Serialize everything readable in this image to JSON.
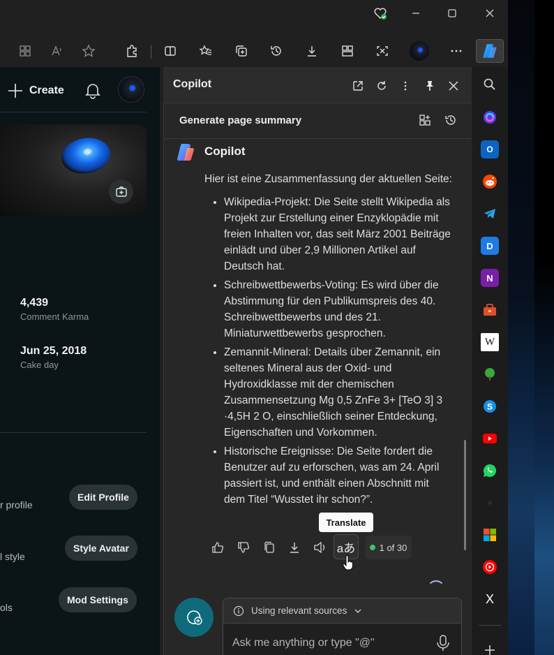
{
  "browser": {
    "icons": [
      "health-icon",
      "minimize-icon",
      "maximize-icon",
      "close-icon"
    ],
    "toolbar_icons": [
      "apps-icon",
      "read-aloud-icon",
      "favorite-star-icon",
      "extensions-icon",
      "split-screen-icon",
      "favorites-icon",
      "collections-icon",
      "history-icon",
      "downloads-icon",
      "workspaces-icon",
      "screenshot-icon",
      "profile-icon",
      "more-icon",
      "copilot-icon"
    ]
  },
  "page": {
    "create_label": "Create",
    "stats": [
      {
        "value": "4,439",
        "label": "Comment Karma"
      },
      {
        "value": "Jun 25, 2018",
        "label": "Cake day"
      }
    ],
    "settings": [
      {
        "partial_text": "r profile",
        "button": "Edit Profile"
      },
      {
        "partial_text": "l style",
        "button": "Style Avatar"
      },
      {
        "partial_text": "ols",
        "button": "Mod Settings"
      }
    ]
  },
  "copilot": {
    "pane_title": "Copilot",
    "summary_title": "Generate page summary",
    "assistant_name": "Copilot",
    "intro": "Hier ist eine Zusammenfassung der aktuellen Seite:",
    "bullets": [
      "Wikipedia-Projekt: Die Seite stellt Wikipedia als Projekt zur Erstellung einer Enzyklopädie mit freien Inhalten vor, das seit März 2001 Beiträge einlädt und über 2,9 Millionen Artikel auf Deutsch hat.",
      "Schreibwettbewerbs-Voting: Es wird über die Abstimmung für den Publikumspreis des 40. Schreibwettbewerbs und des 21. Miniaturwettbewerbs gesprochen.",
      "Zemannit-Mineral: Details über Zemannit, ein seltenes Mineral aus der Oxid- und Hydroxidklasse mit der chemischen Zusammensetzung Mg 0,5 ZnFe 3+ [TeO 3] 3 ·4,5H 2 O, einschließlich seiner Entdeckung, Eigenschaften und Vorkommen.",
      "Historische Ereignisse: Die Seite fordert die Benutzer auf zu erforschen, was am 24. April passiert ist, und enthält einen Abschnitt mit dem Titel “Wusstet ihr schon?”."
    ],
    "tooltip": "Translate",
    "translate_glyph": "aあ",
    "counter": "1 of 30",
    "sources_label": "Using relevant sources",
    "input_placeholder": "Ask me anything or type \"@\""
  },
  "sidebar": {
    "items": [
      "search-icon",
      "copilot-ext-icon",
      "outlook-icon",
      "reddit-icon",
      "telegram-icon",
      "discord-icon",
      "onenote-icon",
      "tools-icon",
      "wikipedia-icon",
      "tree-icon",
      "skype-icon",
      "youtube-icon",
      "whatsapp-icon",
      "blank-icon",
      "microsoft-icon",
      "youtube-music-icon",
      "x-icon",
      "add-icon"
    ],
    "wiki_letter": "W",
    "x_letter": "X"
  }
}
